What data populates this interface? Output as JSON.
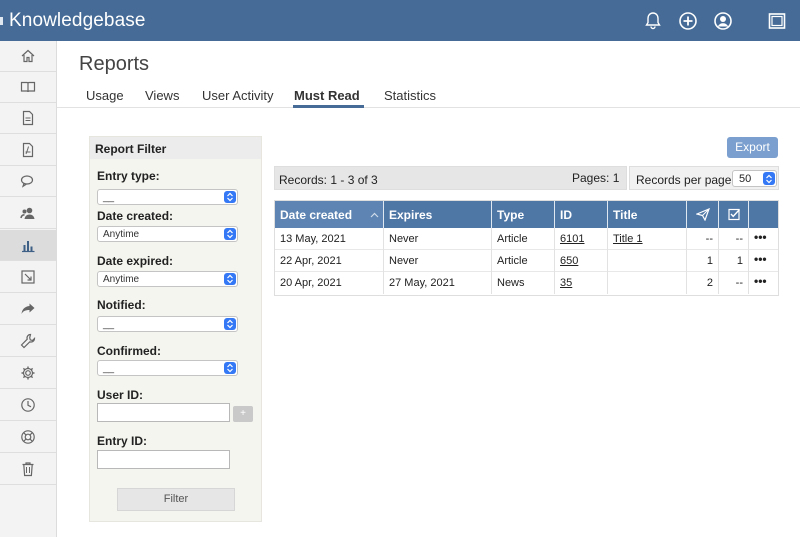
{
  "app": {
    "title": "Knowledgebase",
    "brand_color": "#456b96",
    "top_icons": [
      "bell-icon",
      "plus-circle-icon",
      "user-circle-icon",
      "window-icon"
    ]
  },
  "sidebar": {
    "items": [
      {
        "icon": "home-icon"
      },
      {
        "icon": "book-icon"
      },
      {
        "icon": "document-icon"
      },
      {
        "icon": "pdf-icon"
      },
      {
        "icon": "comments-icon"
      },
      {
        "icon": "users-icon"
      },
      {
        "icon": "bar-chart-icon",
        "active": true
      },
      {
        "icon": "export-icon"
      },
      {
        "icon": "share-icon"
      },
      {
        "icon": "wrench-icon"
      },
      {
        "icon": "gear-icon"
      },
      {
        "icon": "clock-icon"
      },
      {
        "icon": "lifebuoy-icon"
      },
      {
        "icon": "trash-icon"
      }
    ]
  },
  "page": {
    "title": "Reports",
    "tabs": [
      {
        "label": "Usage"
      },
      {
        "label": "Views"
      },
      {
        "label": "User Activity"
      },
      {
        "label": "Must Read",
        "active": true
      },
      {
        "label": "Statistics"
      }
    ]
  },
  "filter": {
    "heading": "Report Filter",
    "entry_type_label": "Entry type:",
    "entry_type_value": "__",
    "date_created_label": "Date created:",
    "date_created_value": "Anytime",
    "date_expired_label": "Date expired:",
    "date_expired_value": "Anytime",
    "notified_label": "Notified:",
    "notified_value": "__",
    "confirmed_label": "Confirmed:",
    "confirmed_value": "__",
    "user_id_label": "User ID:",
    "user_id_value": "",
    "add_user_label": "+",
    "entry_id_label": "Entry ID:",
    "entry_id_value": "",
    "filter_button": "Filter"
  },
  "toolbar": {
    "export_label": "Export",
    "records_text": "Records: 1 - 3 of 3",
    "pages_text": "Pages: 1",
    "records_per_page_label": "Records per page:",
    "records_per_page_value": "50"
  },
  "table": {
    "columns": [
      "Date created",
      "Expires",
      "Type",
      "ID",
      "Title",
      "sent-icon",
      "check-icon",
      ""
    ],
    "rows": [
      {
        "date_created": "13 May, 2021",
        "expires": "Never",
        "type": "Article",
        "id": "6101",
        "title": "Title 1",
        "sent": "--",
        "confirmed": "--",
        "actions": "•••"
      },
      {
        "date_created": "22 Apr, 2021",
        "expires": "Never",
        "type": "Article",
        "id": "650",
        "title": "",
        "sent": "1",
        "confirmed": "1",
        "actions": "•••"
      },
      {
        "date_created": "20 Apr, 2021",
        "expires": "27 May, 2021",
        "type": "News",
        "id": "35",
        "title": "",
        "sent": "2",
        "confirmed": "--",
        "actions": "•••"
      }
    ]
  }
}
